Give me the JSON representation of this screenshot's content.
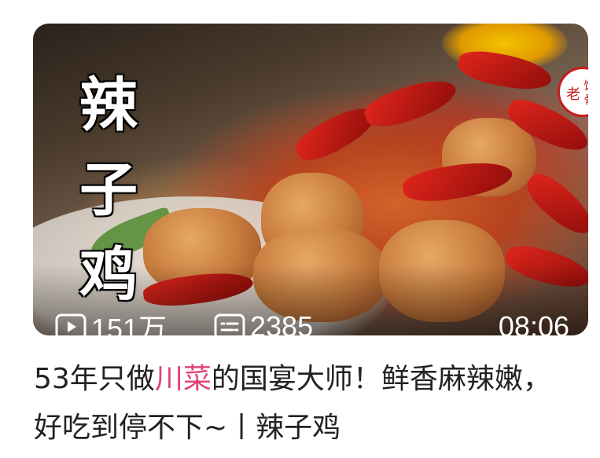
{
  "video": {
    "thumbnail_title": [
      "辣",
      "子",
      "鸡"
    ],
    "logo_text": [
      "老",
      "饭",
      "骨"
    ],
    "play_count": "151万",
    "danmaku_count": "2385",
    "duration": "08:06",
    "title_before": "53年只做",
    "title_highlight": "川菜",
    "title_after": "的国宴大师！鲜香麻辣嫩，好吃到停不下~丨辣子鸡",
    "highlight_color": "#e0447a"
  }
}
